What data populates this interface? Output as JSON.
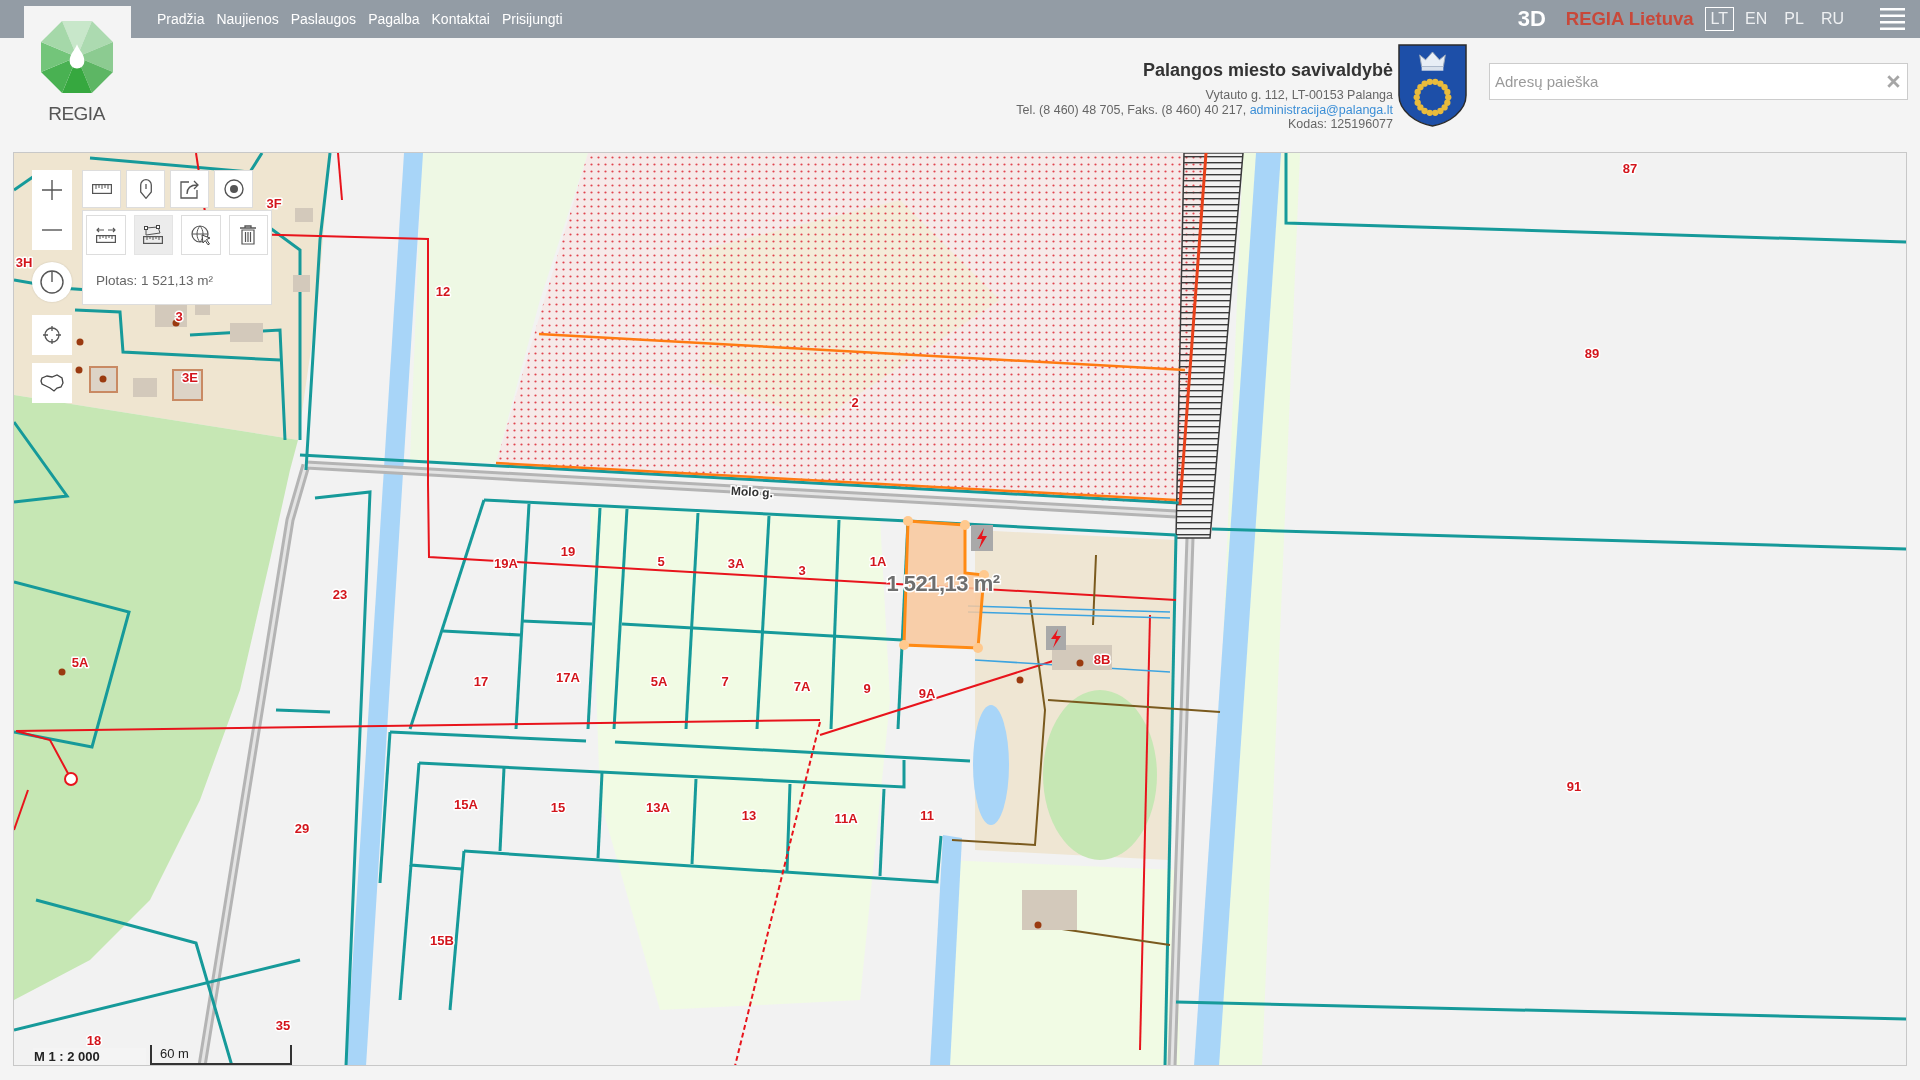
{
  "top_bar": {
    "nav": [
      "Pradžia",
      "Naujienos",
      "Paslaugos",
      "Pagalba",
      "Kontaktai",
      "Prisijungti"
    ],
    "view_3d": "3D",
    "brand": "REGIA Lietuva",
    "languages": [
      {
        "label": "LT",
        "selected": true
      },
      {
        "label": "EN",
        "selected": false
      },
      {
        "label": "PL",
        "selected": false
      },
      {
        "label": "RU",
        "selected": false
      }
    ]
  },
  "logo": {
    "text": "REGIA"
  },
  "municipality": {
    "name": "Palangos miesto savivaldybė",
    "address": "Vytauto g. 112, LT-00153 Palanga",
    "contacts": "Tel. (8 460) 48 705, Faks. (8 460) 40 217,",
    "email": "administracija@palanga.lt",
    "code": "Kodas: 125196077"
  },
  "search": {
    "placeholder": "Adresų paieška"
  },
  "map": {
    "measure_modes": [
      {
        "kind": "distance",
        "selected": false
      },
      {
        "kind": "area",
        "selected": true
      },
      {
        "kind": "select",
        "selected": false
      },
      {
        "kind": "clear",
        "selected": false
      }
    ],
    "measure_result": "Plotas: 1 521,13 m²",
    "street_label": "Molo g.",
    "measured_area_label": "1 521,13 m²",
    "parcel_labels": [
      "87",
      "89",
      "91",
      "2",
      "12",
      "3F",
      "3H",
      "3",
      "3E",
      "5A",
      "23",
      "29",
      "18",
      "35",
      "15B",
      "19A",
      "19",
      "5",
      "3A",
      "3",
      "1A",
      "17",
      "17A",
      "5A",
      "7",
      "7A",
      "9",
      "9A",
      "15A",
      "15",
      "13A",
      "13",
      "11A",
      "11",
      "8B"
    ],
    "scale": "M 1 : 2 000",
    "scale_bar": "60 m"
  }
}
